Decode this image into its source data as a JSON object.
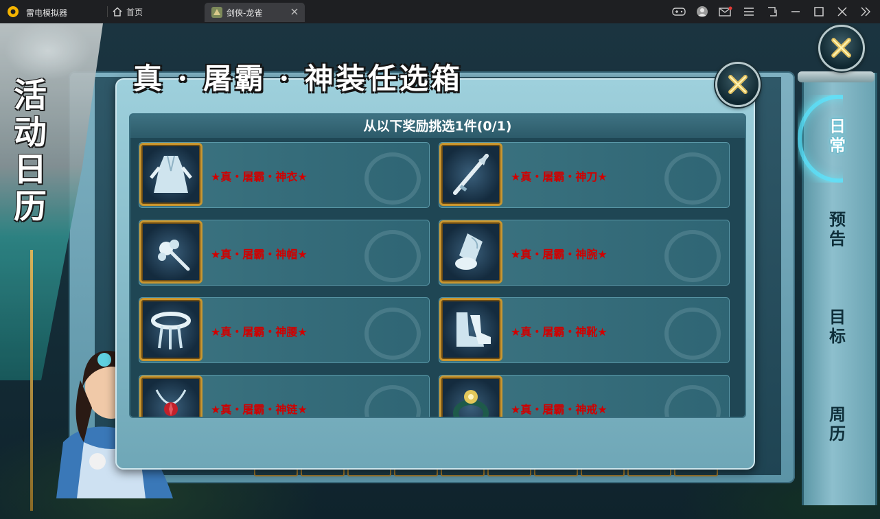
{
  "emulator": {
    "app_name": "雷电模拟器",
    "home_tab": "首页",
    "game_tab": "剑侠-龙雀",
    "icons": [
      "gamepad-icon",
      "avatar-icon",
      "mail-icon",
      "menu-icon",
      "shrink-icon",
      "minimize-icon",
      "maximize-icon",
      "close-icon",
      "collapse-icon"
    ]
  },
  "banner": {
    "title": "活动日历"
  },
  "right_tabs": [
    {
      "label": "日常",
      "active": true
    },
    {
      "label": "预告",
      "active": false
    },
    {
      "label": "目标",
      "active": false
    },
    {
      "label": "周历",
      "active": false
    }
  ],
  "dialog": {
    "title": "真 · 屠霸 · 神装任选箱",
    "subtitle": "从以下奖励挑选1件(0/1)",
    "items": [
      {
        "name": "★真・屠霸・神衣★",
        "icon": "robe-icon"
      },
      {
        "name": "★真・屠霸・神刀★",
        "icon": "blade-icon"
      },
      {
        "name": "★真・屠霸・神帽★",
        "icon": "hairpin-icon"
      },
      {
        "name": "★真・屠霸・神腕★",
        "icon": "bracer-icon"
      },
      {
        "name": "★真・屠霸・神腰★",
        "icon": "belt-icon"
      },
      {
        "name": "★真・屠霸・神靴★",
        "icon": "boots-icon"
      },
      {
        "name": "★真・屠霸・神链★",
        "icon": "necklace-icon"
      },
      {
        "name": "★真・屠霸・神戒★",
        "icon": "ring-icon"
      }
    ]
  },
  "colors": {
    "item_name": "#d00000",
    "frame_gold": "#c9962f",
    "panel": "#1f4654"
  }
}
